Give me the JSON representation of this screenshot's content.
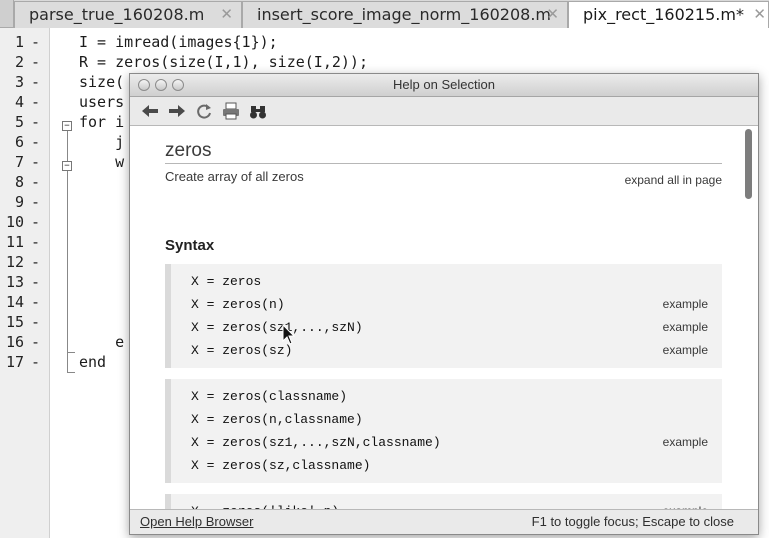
{
  "editor": {
    "tabs": [
      {
        "label": "parse_true_160208.m",
        "close": "✕"
      },
      {
        "label": "insert_score_image_norm_160208.m",
        "close": "✕"
      },
      {
        "label": "pix_rect_160215.m*",
        "close": "✕"
      }
    ],
    "lines": [
      {
        "n": "1",
        "code": "I = imread(images{1});"
      },
      {
        "n": "2",
        "code": "R = zeros(size(I,1), size(I,2));"
      },
      {
        "n": "3",
        "code": "size("
      },
      {
        "n": "4",
        "code": "users"
      },
      {
        "n": "5",
        "code": "for i"
      },
      {
        "n": "6",
        "code": "    j"
      },
      {
        "n": "7",
        "code": "    w"
      },
      {
        "n": "8",
        "code": ""
      },
      {
        "n": "9",
        "code": ""
      },
      {
        "n": "10",
        "code": ""
      },
      {
        "n": "11",
        "code": ""
      },
      {
        "n": "12",
        "code": ""
      },
      {
        "n": "13",
        "code": ""
      },
      {
        "n": "14",
        "code": ""
      },
      {
        "n": "15",
        "code": ""
      },
      {
        "n": "16",
        "code": "    e"
      },
      {
        "n": "17",
        "code": "end"
      }
    ],
    "dash": "-"
  },
  "help": {
    "title": "Help on Selection",
    "toolbar_icons": [
      "back-arrow-icon",
      "forward-arrow-icon",
      "refresh-icon",
      "print-icon",
      "find-binoculars-icon"
    ],
    "function_name": "zeros",
    "purpose": "Create array of all zeros",
    "expand_all": "expand all in page",
    "syntax_heading": "Syntax",
    "syntax_groups": [
      {
        "rows": [
          {
            "code": "X = zeros",
            "example": ""
          },
          {
            "code": "X = zeros(n)",
            "example": "example"
          },
          {
            "code": "X = zeros(sz1,...,szN)",
            "example": "example"
          },
          {
            "code": "X = zeros(sz)",
            "example": "example"
          }
        ]
      },
      {
        "rows": [
          {
            "code": "X = zeros(classname)",
            "example": ""
          },
          {
            "code": "X = zeros(n,classname)",
            "example": ""
          },
          {
            "code": "X = zeros(sz1,...,szN,classname)",
            "example": "example"
          },
          {
            "code": "X = zeros(sz,classname)",
            "example": ""
          }
        ]
      },
      {
        "rows": [
          {
            "code": "X = zeros('like',p)",
            "example": "example"
          }
        ]
      }
    ],
    "open_help_browser": "Open Help Browser",
    "status_hint": "F1 to toggle focus; Escape to close"
  },
  "colors": {
    "tab_bar": "#d9d9d9",
    "gutter": "#efefef",
    "syntax_box": "#f2f2f2",
    "scroll_thumb": "#7d7d7d"
  }
}
